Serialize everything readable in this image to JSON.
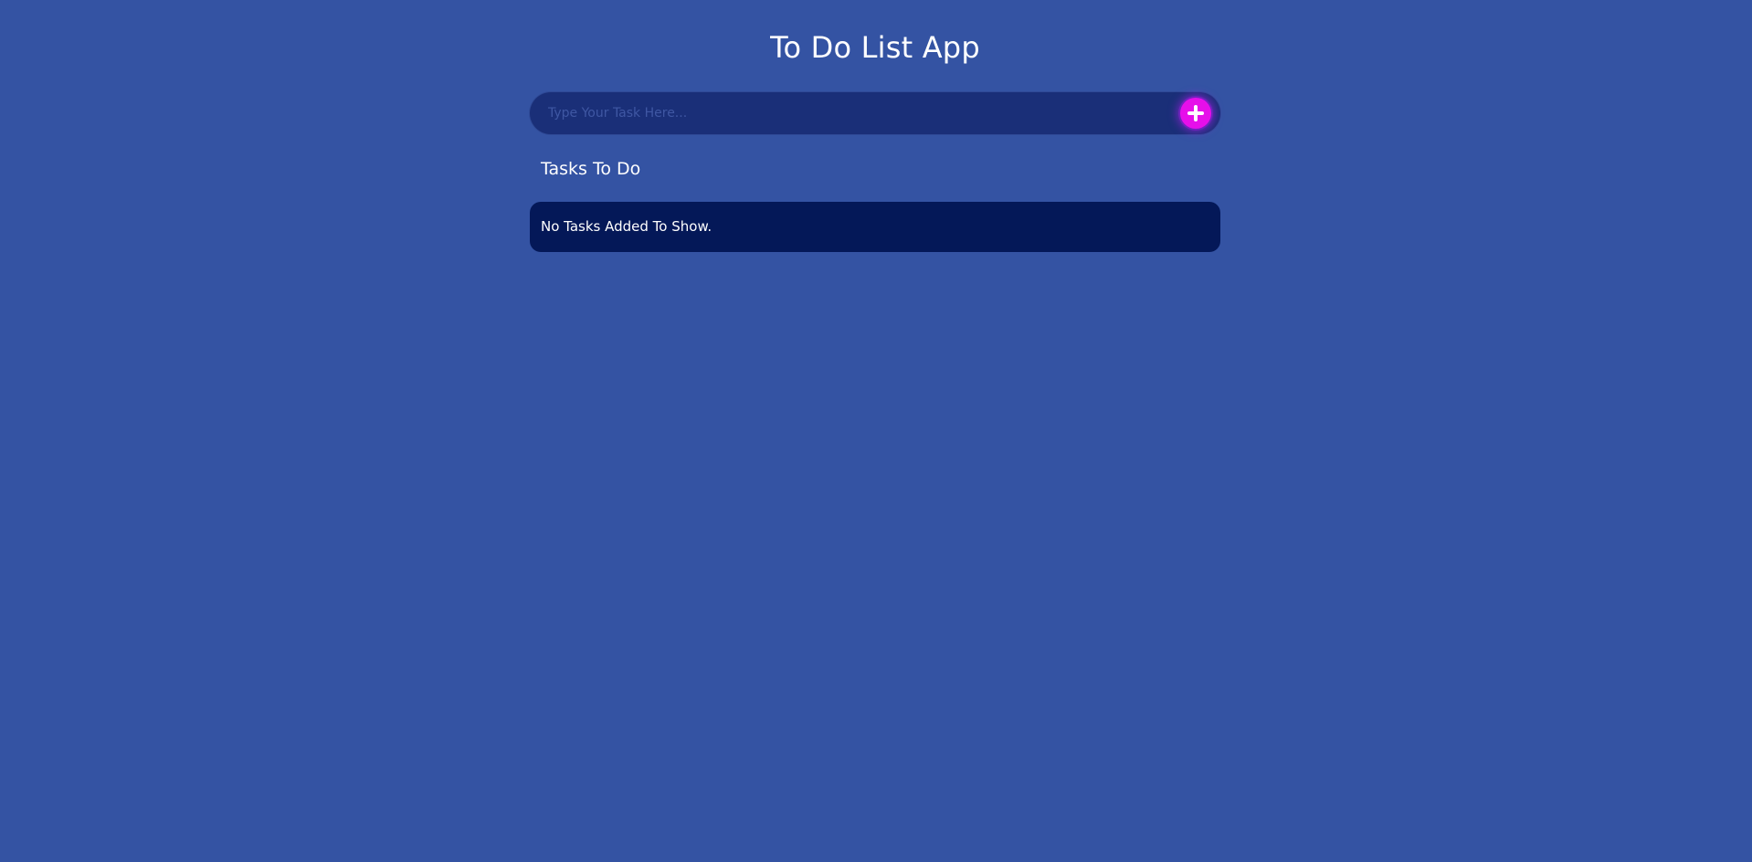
{
  "app": {
    "title": "To Do List App"
  },
  "task_input": {
    "placeholder": "Type Your Task Here...",
    "value": ""
  },
  "add_button": {
    "icon": "plus-icon"
  },
  "tasks_section": {
    "heading": "Tasks To Do",
    "empty_message": "No Tasks Added To Show."
  },
  "colors": {
    "background": "#3453a3",
    "input_bar": "#1a2f78",
    "panel": "#041858",
    "accent": "#e60fea",
    "text": "#ffffff"
  }
}
